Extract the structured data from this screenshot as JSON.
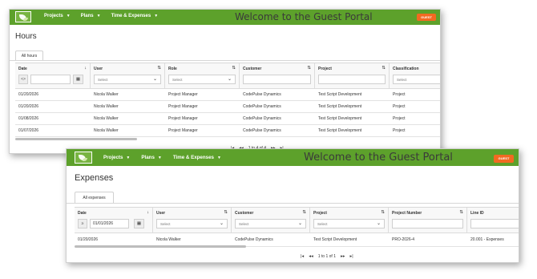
{
  "brand": {
    "primary": "#5da12b",
    "accent": "#f26a21",
    "logo_icon": "leaf-logo-icon"
  },
  "common": {
    "nav": [
      {
        "label": "Projects",
        "icon": "chevron-down-icon"
      },
      {
        "label": "Plans",
        "icon": "chevron-down-icon"
      },
      {
        "label": "Time & Expenses",
        "icon": "chevron-down-icon"
      }
    ],
    "welcome": "Welcome to the Guest Portal",
    "guest_button": "GUEST"
  },
  "hours": {
    "title": "Hours",
    "tab": "All hours",
    "columns": [
      {
        "label": "Date",
        "sort": "↓"
      },
      {
        "label": "User",
        "sort": "⇅"
      },
      {
        "label": "Role",
        "sort": "⇅"
      },
      {
        "label": "Customer",
        "sort": "⇅"
      },
      {
        "label": "Project",
        "sort": "⇅"
      },
      {
        "label": "Classification",
        "sort": ""
      }
    ],
    "filters": {
      "date_operator": "<>",
      "date_value": "",
      "user_placeholder": "Select",
      "role_placeholder": "Select",
      "classification_placeholder": "Select"
    },
    "rows": [
      [
        "01/20/2026",
        "Nicola Walker",
        "Project Manager",
        "CodePulse Dynamics",
        "Test Script Development",
        "Project"
      ],
      [
        "01/20/2026",
        "Nicola Walker",
        "Project Manager",
        "CodePulse Dynamics",
        "Test Script Development",
        "Project"
      ],
      [
        "01/08/2026",
        "Nicola Walker",
        "Project Manager",
        "CodePulse Dynamics",
        "Test Script Development",
        "Project"
      ],
      [
        "01/07/2026",
        "Nicola Walker",
        "Project Manager",
        "CodePulse Dynamics",
        "Test Script Development",
        "Project"
      ]
    ],
    "pager": {
      "summary": "1 to 4 of 4"
    }
  },
  "expenses": {
    "title": "Expenses",
    "tab": "All expenses",
    "columns": [
      {
        "label": "Date",
        "sort": "↓"
      },
      {
        "label": "User",
        "sort": "⇅"
      },
      {
        "label": "Customer",
        "sort": "⇅"
      },
      {
        "label": "Project",
        "sort": "⇅"
      },
      {
        "label": "Project Number",
        "sort": "⇅"
      },
      {
        "label": "Line ID",
        "sort": ""
      }
    ],
    "filters": {
      "date_operator": "≥",
      "date_value": "01/01/2026",
      "user_placeholder": "Select",
      "customer_placeholder": "Select",
      "project_placeholder": "Select"
    },
    "rows": [
      [
        "01/20/2026",
        "Nicola Walker",
        "CodePulse Dynamics",
        "Test Script Development",
        "PRO-2026-4",
        "20.001 - Expenses"
      ]
    ],
    "pager": {
      "summary": "1 to 1 of 1"
    }
  }
}
